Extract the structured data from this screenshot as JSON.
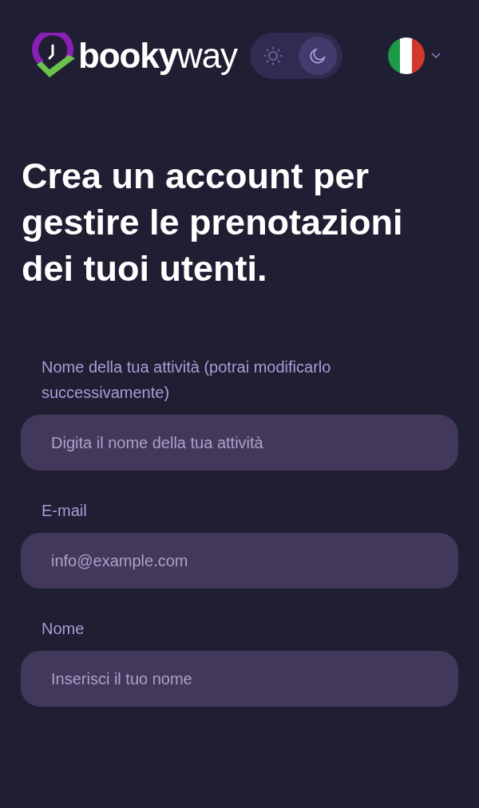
{
  "logo": {
    "text": "**booky**way"
  },
  "theme_toggle": [
    {
      "kind": "light",
      "selected": false
    },
    {
      "kind": "dark",
      "selected": true
    }
  ],
  "heading": "Crea un account per gestire le prenotazioni dei tuoi utenti.",
  "fields": [
    {
      "label": "Nome della tua attività (potrai modificarlo successivamente)",
      "placeholder": "Digita il nome della tua attività"
    },
    {
      "label": "E-mail",
      "placeholder": "info@example.com"
    },
    {
      "label": "Nome",
      "placeholder": "Inserisci il tuo nome"
    }
  ]
}
